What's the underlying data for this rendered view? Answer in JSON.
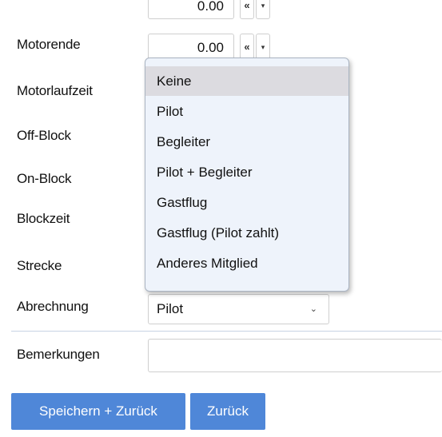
{
  "fields": {
    "prev_value": "0.00",
    "prev_btn_label": "«",
    "prev_caret": "▾",
    "motorende_label": "Motorende",
    "motorende_value": "0.00",
    "motorende_btn_label": "«",
    "motorende_caret": "▾",
    "motorlaufzeit_label": "Motorlaufzeit",
    "offblock_label": "Off-Block",
    "onblock_label": "On-Block",
    "blockzeit_label": "Blockzeit",
    "strecke_label": "Strecke",
    "abrechnung_label": "Abrechnung",
    "abrechnung_value": "Pilot",
    "abrechnung_chevron": "⌄",
    "bemerkungen_label": "Bemerkungen",
    "bemerkungen_value": ""
  },
  "dropdown": {
    "options": [
      "Keine",
      "Pilot",
      "Begleiter",
      "Pilot + Begleiter",
      "Gastflug",
      "Gastflug (Pilot zahlt)",
      "Anderes Mitglied"
    ],
    "highlighted": "Keine"
  },
  "actions": {
    "save_back_label": "Speichern + Zurück",
    "back_label": "Zurück"
  },
  "colors": {
    "button_bg": "#4f87d8",
    "dropdown_bg": "#eef3fb",
    "highlight_bg": "#dcdbe0"
  }
}
